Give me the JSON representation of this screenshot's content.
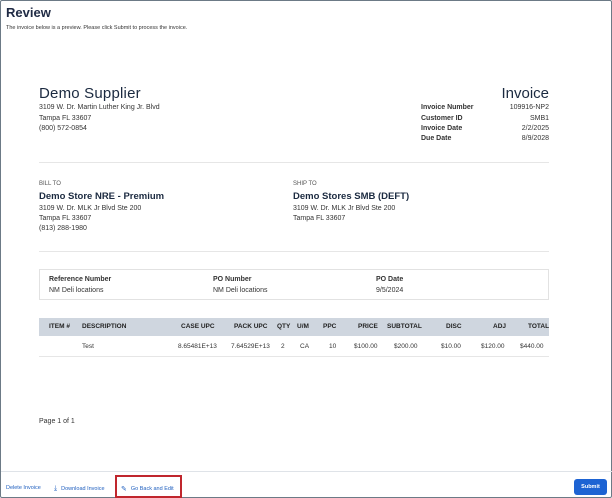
{
  "page": {
    "title": "Review",
    "subtitle": "The invoice below is a preview. Please click Submit to process the invoice."
  },
  "supplier": {
    "name": "Demo Supplier",
    "address1": "3109 W. Dr. Martin Luther King Jr. Blvd",
    "address2": "Tampa FL 33607",
    "phone": "(800) 572-0854"
  },
  "invoice": {
    "title": "Invoice",
    "meta": [
      {
        "label": "Invoice Number",
        "value": "109916-NP2"
      },
      {
        "label": "Customer ID",
        "value": "SMB1"
      },
      {
        "label": "Invoice Date",
        "value": "2/2/2025"
      },
      {
        "label": "Due Date",
        "value": "8/9/2028"
      }
    ]
  },
  "bill_to": {
    "label": "BILL TO",
    "name": "Demo Store NRE - Premium",
    "address1": "3109 W. Dr. MLK Jr Blvd Ste 200",
    "address2": "Tampa FL 33607",
    "phone": "(813) 288-1980"
  },
  "ship_to": {
    "label": "SHIP TO",
    "name": "Demo Stores SMB (DEFT)",
    "address1": "3109 W. Dr. MLK Jr Blvd Ste 200",
    "address2": "Tampa FL 33607"
  },
  "reference": {
    "ref_label": "Reference Number",
    "ref_value": "NM Deli locations",
    "po_label": "PO Number",
    "po_value": "NM Deli locations",
    "po_date_label": "PO Date",
    "po_date_value": "9/5/2024"
  },
  "table": {
    "headers": [
      "ITEM #",
      "DESCRIPTION",
      "CASE UPC",
      "PACK UPC",
      "QTY",
      "U/M",
      "PPC",
      "PRICE",
      "SUBTOTAL",
      "DISC",
      "ADJ",
      "TOTAL"
    ],
    "rows": [
      [
        "",
        "Test",
        "8.65481E+13",
        "7.64529E+13",
        "2",
        "CA",
        "10",
        "$100.00",
        "$200.00",
        "$10.00",
        "$120.00",
        "$440.00"
      ]
    ]
  },
  "pagination": "Page 1 of 1",
  "footer": {
    "delete": "Delete Invoice",
    "download": "Download Invoice",
    "go_back": "Go Back and Edit",
    "submit": "Submit"
  }
}
